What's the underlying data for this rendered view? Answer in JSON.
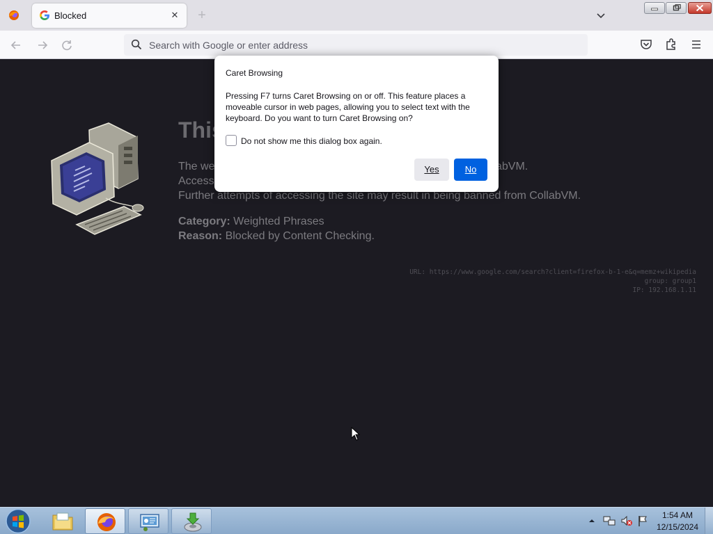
{
  "browser": {
    "tab_title": "Blocked",
    "new_tab_label": "+",
    "url_placeholder": "Search with Google or enter address",
    "url_value": ""
  },
  "page": {
    "heading": "This",
    "line1": "The we",
    "line1_tail": "abVM.",
    "line2": "Accessi",
    "line3": "Further attempts of accessing the site may result in being banned from CollabVM.",
    "category_label": "Category:",
    "category_value": "Weighted Phrases",
    "reason_label": "Reason:",
    "reason_value": "Blocked by Content Checking.",
    "meta_url": "URL: https://www.google.com/search?client=firefox-b-1-e&q=memz+wikipedia",
    "meta_group": "group: group1",
    "meta_ip": "IP: 192.168.1.11"
  },
  "dialog": {
    "title": "Caret Browsing",
    "message": "Pressing F7 turns Caret Browsing on or off. This feature places a moveable cursor in web pages, allowing you to select text with the keyboard. Do you want to turn Caret Browsing on?",
    "checkbox_label": "Do not show me this dialog box again.",
    "checkbox_checked": false,
    "yes_label": "Yes",
    "no_label": "No"
  },
  "taskbar": {
    "time": "1:54 AM",
    "date": "12/15/2024",
    "items": [
      "windows-explorer",
      "firefox",
      "control-panel",
      "setup"
    ]
  },
  "colors": {
    "page_background": "#1c1b22",
    "primary_button": "#0061e0",
    "taskbar": "#9db8d6"
  }
}
